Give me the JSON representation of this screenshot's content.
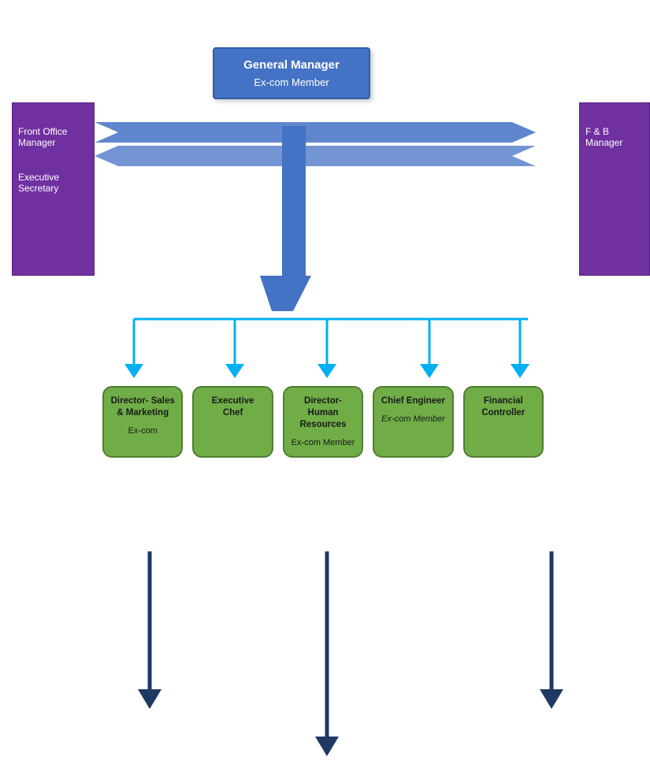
{
  "gm": {
    "title": "General Manager",
    "subtitle": "Ex-com Member"
  },
  "left_box": {
    "label1": "Front Office Manager",
    "label2": "Executive Secretary"
  },
  "right_box": {
    "label1": "F & B",
    "label2": "Manager"
  },
  "green_boxes": [
    {
      "title": "Director- Sales & Marketing",
      "subtitle": "Ex-com"
    },
    {
      "title": "Executive Chef",
      "subtitle": ""
    },
    {
      "title": "Director- Human Resources",
      "subtitle": "Ex-com Member"
    },
    {
      "title": "Chief Engineer",
      "subtitle": "Ex-com Member"
    },
    {
      "title": "Financial Controller",
      "subtitle": ""
    }
  ]
}
